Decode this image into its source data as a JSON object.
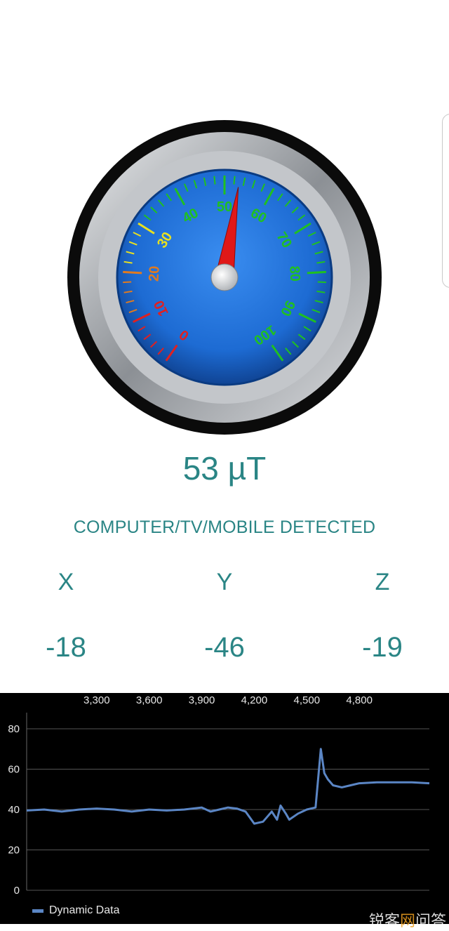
{
  "gauge": {
    "min": 0,
    "max": 100,
    "value": 53,
    "tick_labels": [
      "0",
      "10",
      "20",
      "30",
      "40",
      "50",
      "60",
      "70",
      "80",
      "90",
      "100"
    ],
    "colors": {
      "outer_ring": "#0b0b0b",
      "bezel": "#b9bcc0",
      "dial": "#1f6fd8",
      "needle": "#e01818",
      "label_low": "#e02020",
      "label_mid": "#e07a1f",
      "label_warm": "#e8e020",
      "label_high": "#20c020"
    }
  },
  "reading": {
    "value": "53 µT",
    "status": "COMPUTER/TV/MOBILE DETECTED"
  },
  "axes": [
    {
      "label": "X",
      "value": "-18"
    },
    {
      "label": "Y",
      "value": "-46"
    },
    {
      "label": "Z",
      "value": "-19"
    }
  ],
  "chart_data": {
    "type": "line",
    "x_tick_labels": [
      "3,300",
      "3,600",
      "3,900",
      "4,200",
      "4,500",
      "4,800"
    ],
    "y_tick_labels": [
      "0",
      "20",
      "40",
      "60",
      "80"
    ],
    "ylim": [
      0,
      88
    ],
    "grid": true,
    "legend_position": "bottom-left",
    "series": [
      {
        "name": "Dynamic Data",
        "color": "#5b86c5",
        "x": [
          2900,
          3000,
          3100,
          3200,
          3300,
          3400,
          3500,
          3600,
          3700,
          3800,
          3900,
          3950,
          4000,
          4050,
          4100,
          4150,
          4200,
          4250,
          4300,
          4330,
          4350,
          4380,
          4400,
          4450,
          4500,
          4550,
          4580,
          4600,
          4620,
          4650,
          4700,
          4750,
          4800,
          4900,
          5000,
          5100,
          5200
        ],
        "values": [
          39.5,
          40,
          39,
          40,
          40.5,
          40,
          39,
          40,
          39.5,
          40,
          41,
          39,
          40,
          41,
          40.5,
          39,
          33,
          34,
          39,
          35,
          42,
          38,
          35,
          38,
          40,
          41,
          70,
          58,
          55,
          52,
          51,
          52,
          53,
          53.5,
          53.5,
          53.5,
          53
        ]
      }
    ]
  },
  "watermark": {
    "part1": "锐客",
    "part2": "网",
    "part3": "问答"
  }
}
